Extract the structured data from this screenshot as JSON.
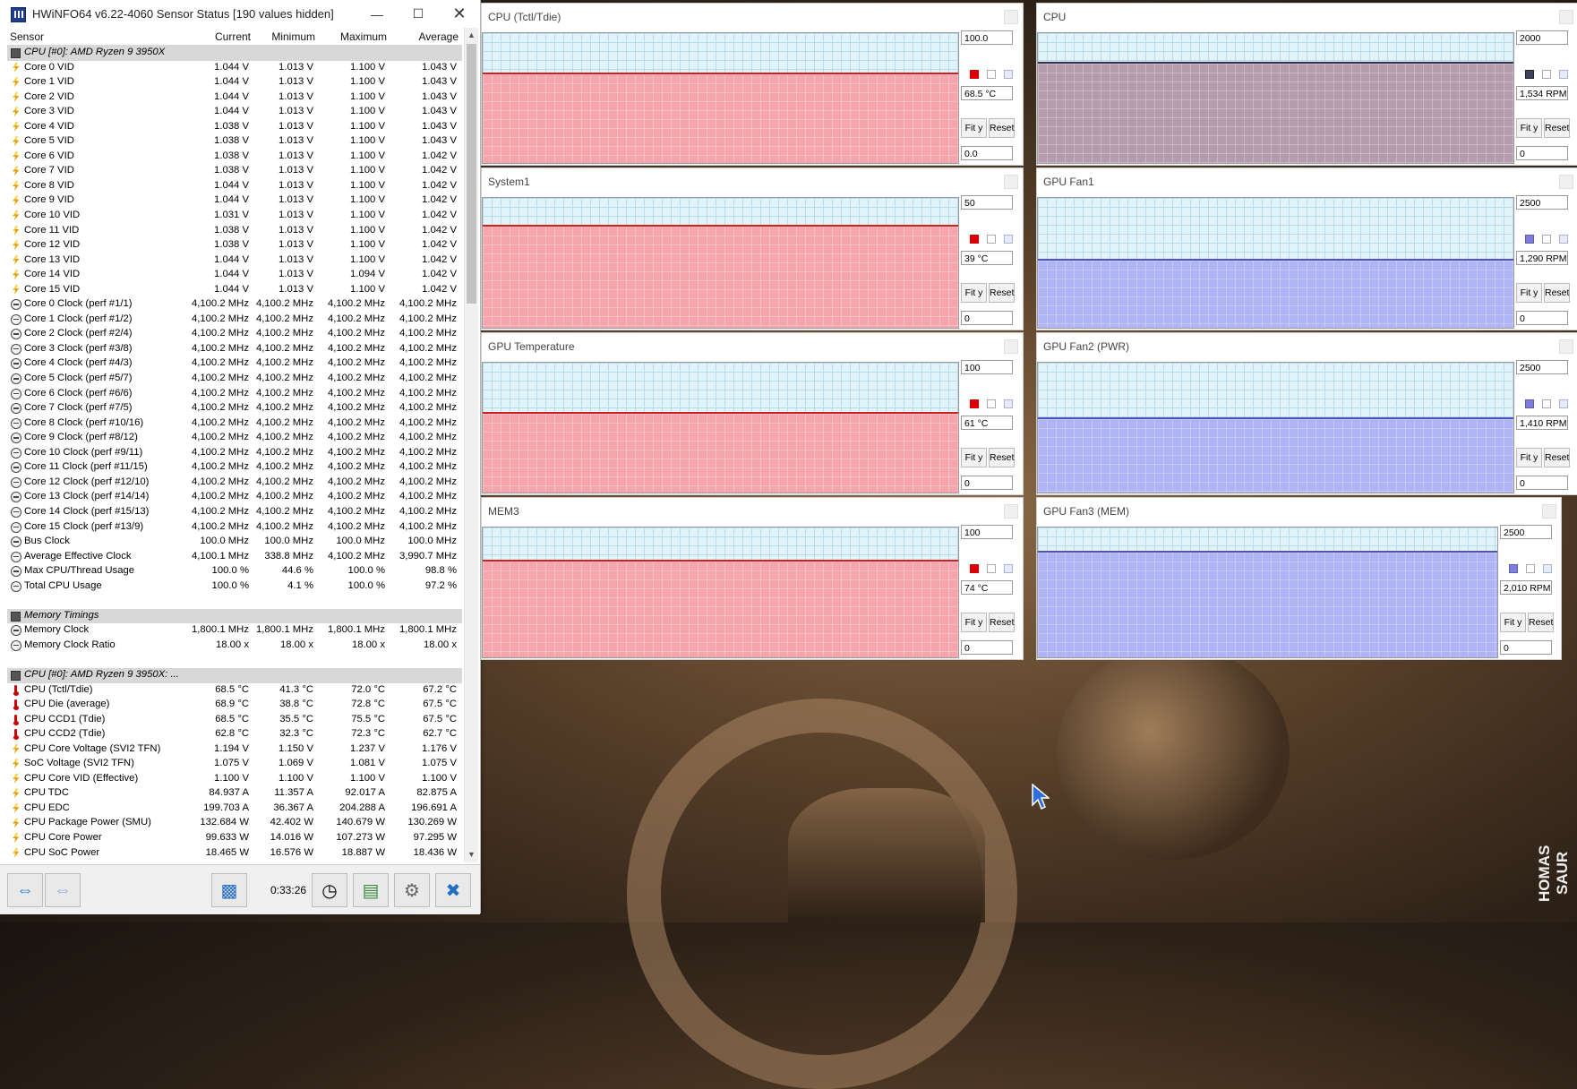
{
  "window": {
    "title": "HWiNFO64 v6.22-4060 Sensor Status [190 values hidden]",
    "columns": [
      "Sensor",
      "Current",
      "Minimum",
      "Maximum",
      "Average"
    ],
    "elapsed": "0:33:26"
  },
  "rows": [
    {
      "type": "group",
      "name": "CPU [#0]: AMD Ryzen 9 3950X"
    },
    {
      "type": "volt",
      "name": "Core 0 VID",
      "v": [
        "1.044 V",
        "1.013 V",
        "1.100 V",
        "1.043 V"
      ]
    },
    {
      "type": "volt",
      "name": "Core 1 VID",
      "v": [
        "1.044 V",
        "1.013 V",
        "1.100 V",
        "1.043 V"
      ]
    },
    {
      "type": "volt",
      "name": "Core 2 VID",
      "v": [
        "1.044 V",
        "1.013 V",
        "1.100 V",
        "1.043 V"
      ]
    },
    {
      "type": "volt",
      "name": "Core 3 VID",
      "v": [
        "1.044 V",
        "1.013 V",
        "1.100 V",
        "1.043 V"
      ]
    },
    {
      "type": "volt",
      "name": "Core 4 VID",
      "v": [
        "1.038 V",
        "1.013 V",
        "1.100 V",
        "1.043 V"
      ]
    },
    {
      "type": "volt",
      "name": "Core 5 VID",
      "v": [
        "1.038 V",
        "1.013 V",
        "1.100 V",
        "1.043 V"
      ]
    },
    {
      "type": "volt",
      "name": "Core 6 VID",
      "v": [
        "1.038 V",
        "1.013 V",
        "1.100 V",
        "1.042 V"
      ]
    },
    {
      "type": "volt",
      "name": "Core 7 VID",
      "v": [
        "1.038 V",
        "1.013 V",
        "1.100 V",
        "1.042 V"
      ]
    },
    {
      "type": "volt",
      "name": "Core 8 VID",
      "v": [
        "1.044 V",
        "1.013 V",
        "1.100 V",
        "1.042 V"
      ]
    },
    {
      "type": "volt",
      "name": "Core 9 VID",
      "v": [
        "1.044 V",
        "1.013 V",
        "1.100 V",
        "1.042 V"
      ]
    },
    {
      "type": "volt",
      "name": "Core 10 VID",
      "v": [
        "1.031 V",
        "1.013 V",
        "1.100 V",
        "1.042 V"
      ]
    },
    {
      "type": "volt",
      "name": "Core 11 VID",
      "v": [
        "1.038 V",
        "1.013 V",
        "1.100 V",
        "1.042 V"
      ]
    },
    {
      "type": "volt",
      "name": "Core 12 VID",
      "v": [
        "1.038 V",
        "1.013 V",
        "1.100 V",
        "1.042 V"
      ]
    },
    {
      "type": "volt",
      "name": "Core 13 VID",
      "v": [
        "1.044 V",
        "1.013 V",
        "1.100 V",
        "1.042 V"
      ]
    },
    {
      "type": "volt",
      "name": "Core 14 VID",
      "v": [
        "1.044 V",
        "1.013 V",
        "1.094 V",
        "1.042 V"
      ]
    },
    {
      "type": "volt",
      "name": "Core 15 VID",
      "v": [
        "1.044 V",
        "1.013 V",
        "1.100 V",
        "1.042 V"
      ]
    },
    {
      "type": "clk",
      "name": "Core 0 Clock (perf #1/1)",
      "v": [
        "4,100.2 MHz",
        "4,100.2 MHz",
        "4,100.2 MHz",
        "4,100.2 MHz"
      ]
    },
    {
      "type": "clk",
      "name": "Core 1 Clock (perf #1/2)",
      "v": [
        "4,100.2 MHz",
        "4,100.2 MHz",
        "4,100.2 MHz",
        "4,100.2 MHz"
      ]
    },
    {
      "type": "clk",
      "name": "Core 2 Clock (perf #2/4)",
      "v": [
        "4,100.2 MHz",
        "4,100.2 MHz",
        "4,100.2 MHz",
        "4,100.2 MHz"
      ]
    },
    {
      "type": "clk",
      "name": "Core 3 Clock (perf #3/8)",
      "v": [
        "4,100.2 MHz",
        "4,100.2 MHz",
        "4,100.2 MHz",
        "4,100.2 MHz"
      ]
    },
    {
      "type": "clk",
      "name": "Core 4 Clock (perf #4/3)",
      "v": [
        "4,100.2 MHz",
        "4,100.2 MHz",
        "4,100.2 MHz",
        "4,100.2 MHz"
      ]
    },
    {
      "type": "clk",
      "name": "Core 5 Clock (perf #5/7)",
      "v": [
        "4,100.2 MHz",
        "4,100.2 MHz",
        "4,100.2 MHz",
        "4,100.2 MHz"
      ]
    },
    {
      "type": "clk",
      "name": "Core 6 Clock (perf #6/6)",
      "v": [
        "4,100.2 MHz",
        "4,100.2 MHz",
        "4,100.2 MHz",
        "4,100.2 MHz"
      ]
    },
    {
      "type": "clk",
      "name": "Core 7 Clock (perf #7/5)",
      "v": [
        "4,100.2 MHz",
        "4,100.2 MHz",
        "4,100.2 MHz",
        "4,100.2 MHz"
      ]
    },
    {
      "type": "clk",
      "name": "Core 8 Clock (perf #10/16)",
      "v": [
        "4,100.2 MHz",
        "4,100.2 MHz",
        "4,100.2 MHz",
        "4,100.2 MHz"
      ]
    },
    {
      "type": "clk",
      "name": "Core 9 Clock (perf #8/12)",
      "v": [
        "4,100.2 MHz",
        "4,100.2 MHz",
        "4,100.2 MHz",
        "4,100.2 MHz"
      ]
    },
    {
      "type": "clk",
      "name": "Core 10 Clock (perf #9/11)",
      "v": [
        "4,100.2 MHz",
        "4,100.2 MHz",
        "4,100.2 MHz",
        "4,100.2 MHz"
      ]
    },
    {
      "type": "clk",
      "name": "Core 11 Clock (perf #11/15)",
      "v": [
        "4,100.2 MHz",
        "4,100.2 MHz",
        "4,100.2 MHz",
        "4,100.2 MHz"
      ]
    },
    {
      "type": "clk",
      "name": "Core 12 Clock (perf #12/10)",
      "v": [
        "4,100.2 MHz",
        "4,100.2 MHz",
        "4,100.2 MHz",
        "4,100.2 MHz"
      ]
    },
    {
      "type": "clk",
      "name": "Core 13 Clock (perf #14/14)",
      "v": [
        "4,100.2 MHz",
        "4,100.2 MHz",
        "4,100.2 MHz",
        "4,100.2 MHz"
      ]
    },
    {
      "type": "clk",
      "name": "Core 14 Clock (perf #15/13)",
      "v": [
        "4,100.2 MHz",
        "4,100.2 MHz",
        "4,100.2 MHz",
        "4,100.2 MHz"
      ]
    },
    {
      "type": "clk",
      "name": "Core 15 Clock (perf #13/9)",
      "v": [
        "4,100.2 MHz",
        "4,100.2 MHz",
        "4,100.2 MHz",
        "4,100.2 MHz"
      ]
    },
    {
      "type": "clk",
      "name": "Bus Clock",
      "v": [
        "100.0 MHz",
        "100.0 MHz",
        "100.0 MHz",
        "100.0 MHz"
      ]
    },
    {
      "type": "clk",
      "name": "Average Effective Clock",
      "v": [
        "4,100.1 MHz",
        "338.8 MHz",
        "4,100.2 MHz",
        "3,990.7 MHz"
      ]
    },
    {
      "type": "clk",
      "name": "Max CPU/Thread Usage",
      "v": [
        "100.0 %",
        "44.6 %",
        "100.0 %",
        "98.8 %"
      ]
    },
    {
      "type": "clk",
      "name": "Total CPU Usage",
      "v": [
        "100.0 %",
        "4.1 %",
        "100.0 %",
        "97.2 %"
      ]
    },
    {
      "type": "blank",
      "name": ""
    },
    {
      "type": "group",
      "name": "Memory Timings"
    },
    {
      "type": "clk",
      "name": "Memory Clock",
      "v": [
        "1,800.1 MHz",
        "1,800.1 MHz",
        "1,800.1 MHz",
        "1,800.1 MHz"
      ]
    },
    {
      "type": "clk",
      "name": "Memory Clock Ratio",
      "v": [
        "18.00 x",
        "18.00 x",
        "18.00 x",
        "18.00 x"
      ]
    },
    {
      "type": "blank",
      "name": ""
    },
    {
      "type": "group",
      "name": "CPU [#0]: AMD Ryzen 9 3950X: ..."
    },
    {
      "type": "temp",
      "name": "CPU (Tctl/Tdie)",
      "v": [
        "68.5 °C",
        "41.3 °C",
        "72.0 °C",
        "67.2 °C"
      ]
    },
    {
      "type": "temp",
      "name": "CPU Die (average)",
      "v": [
        "68.9 °C",
        "38.8 °C",
        "72.8 °C",
        "67.5 °C"
      ]
    },
    {
      "type": "temp",
      "name": "CPU CCD1 (Tdie)",
      "v": [
        "68.5 °C",
        "35.5 °C",
        "75.5 °C",
        "67.5 °C"
      ]
    },
    {
      "type": "temp",
      "name": "CPU CCD2 (Tdie)",
      "v": [
        "62.8 °C",
        "32.3 °C",
        "72.3 °C",
        "62.7 °C"
      ]
    },
    {
      "type": "volt",
      "name": "CPU Core Voltage (SVI2 TFN)",
      "v": [
        "1.194 V",
        "1.150 V",
        "1.237 V",
        "1.176 V"
      ]
    },
    {
      "type": "volt",
      "name": "SoC Voltage (SVI2 TFN)",
      "v": [
        "1.075 V",
        "1.069 V",
        "1.081 V",
        "1.075 V"
      ]
    },
    {
      "type": "volt",
      "name": "CPU Core VID (Effective)",
      "v": [
        "1.100 V",
        "1.100 V",
        "1.100 V",
        "1.100 V"
      ]
    },
    {
      "type": "pwr",
      "name": "CPU TDC",
      "v": [
        "84.937 A",
        "11.357 A",
        "92.017 A",
        "82.875 A"
      ]
    },
    {
      "type": "pwr",
      "name": "CPU EDC",
      "v": [
        "199.703 A",
        "36.367 A",
        "204.288 A",
        "196.691 A"
      ]
    },
    {
      "type": "pwr",
      "name": "CPU Package Power (SMU)",
      "v": [
        "132.684 W",
        "42.402 W",
        "140.679 W",
        "130.269 W"
      ]
    },
    {
      "type": "pwr",
      "name": "CPU Core Power",
      "v": [
        "99.633 W",
        "14.016 W",
        "107.273 W",
        "97.295 W"
      ]
    },
    {
      "type": "pwr",
      "name": "CPU SoC Power",
      "v": [
        "18.465 W",
        "16.576 W",
        "18.887 W",
        "18.436 W"
      ]
    }
  ],
  "graphs": [
    {
      "title": "CPU (Tctl/Tdie)",
      "max": "100.0",
      "current": "68.5 °C",
      "min": "0.0",
      "level": 0.685,
      "color": "#f4a6ac",
      "line": "#d02020",
      "swatch": "red"
    },
    {
      "title": "CPU",
      "max": "2000",
      "current": "1,534 RPM",
      "min": "0",
      "level": 0.767,
      "color": "#b49cac",
      "line": "#303050",
      "swatch": "dark"
    },
    {
      "title": "System1",
      "max": "50",
      "current": "39 °C",
      "min": "0",
      "level": 0.78,
      "color": "#f4a6ac",
      "line": "#d02020",
      "swatch": "red"
    },
    {
      "title": "GPU Fan1",
      "max": "2500",
      "current": "1,290 RPM",
      "min": "0",
      "level": 0.516,
      "color": "#aeb4f4",
      "line": "#5050c0",
      "swatch": "blue"
    },
    {
      "title": "GPU Temperature",
      "max": "100",
      "current": "61 °C",
      "min": "0",
      "level": 0.61,
      "color": "#f4a6ac",
      "line": "#d02020",
      "swatch": "red"
    },
    {
      "title": "GPU Fan2 (PWR)",
      "max": "2500",
      "current": "1,410 RPM",
      "min": "0",
      "level": 0.564,
      "color": "#aeb4f4",
      "line": "#5050c0",
      "swatch": "blue"
    },
    {
      "title": "MEM3",
      "max": "100",
      "current": "74 °C",
      "min": "0",
      "level": 0.74,
      "color": "#f4a6ac",
      "line": "#d02020",
      "swatch": "red"
    },
    {
      "title": "GPU Fan3 (MEM)",
      "max": "2500",
      "current": "2,010 RPM",
      "min": "0",
      "level": 0.804,
      "color": "#aeb4f4",
      "line": "#5050c0",
      "swatch": "blue"
    }
  ],
  "graph_buttons": {
    "fit": "Fit y",
    "reset": "Reset"
  },
  "watermark": "HOMAS SAUR"
}
